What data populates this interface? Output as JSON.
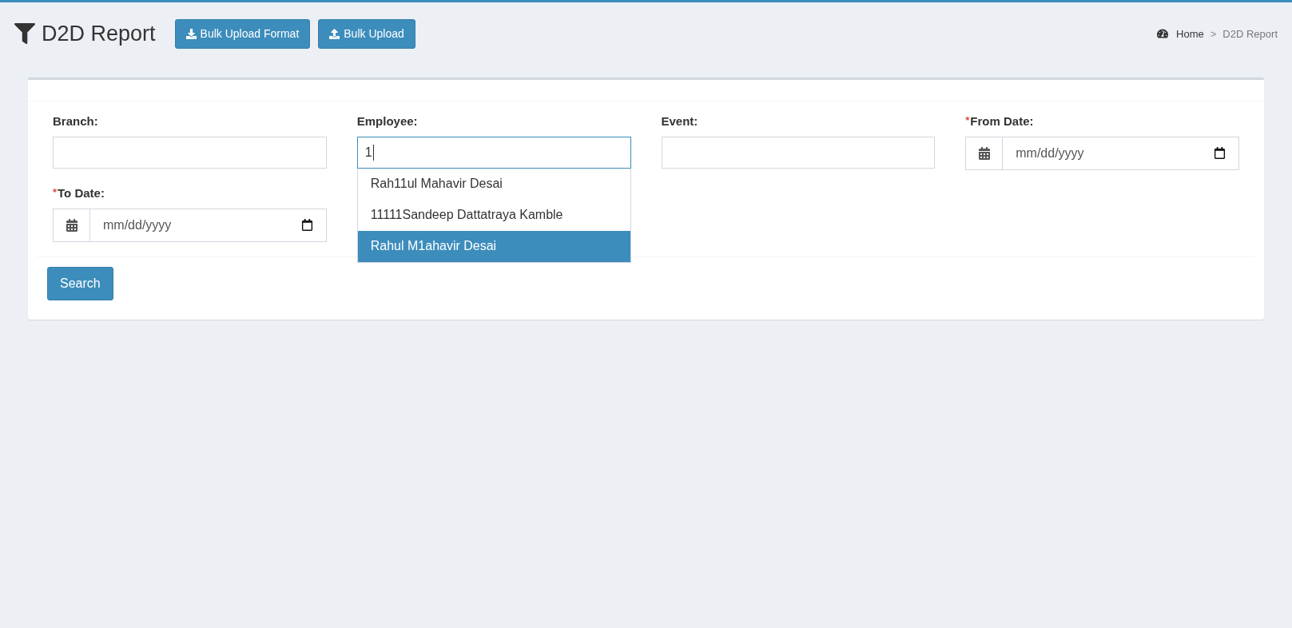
{
  "header": {
    "title": "D2D Report",
    "buttons": [
      {
        "label": "Bulk Upload Format",
        "kind": "download"
      },
      {
        "label": "Bulk Upload",
        "kind": "upload"
      }
    ]
  },
  "breadcrumb": {
    "items": [
      {
        "label": "Home",
        "kind": "home"
      },
      {
        "label": "D2D Report",
        "kind": "current"
      }
    ],
    "separator": ">"
  },
  "filters": [
    {
      "label": "Branch:",
      "required": false,
      "kind": "text",
      "focused": false
    },
    {
      "label": "Employee:",
      "required": false,
      "kind": "text",
      "focused": true,
      "value": "1",
      "suggestions": [
        {
          "label": "Rah11ul Mahavir Desai",
          "selected": false
        },
        {
          "label": "11111Sandeep Dattatraya Kamble",
          "selected": false
        },
        {
          "label": "Rahul M1ahavir Desai",
          "selected": true
        }
      ]
    },
    {
      "label": "Event:",
      "required": false,
      "kind": "text",
      "focused": false
    },
    {
      "label": "From Date:",
      "required": true,
      "kind": "date",
      "focused": false,
      "placeholder": "mm/dd/yyyy"
    },
    {
      "label": "To Date:",
      "required": true,
      "kind": "date",
      "focused": false,
      "placeholder": "mm/dd/yyyy"
    }
  ],
  "required_mark": "*",
  "search_button": "Search"
}
